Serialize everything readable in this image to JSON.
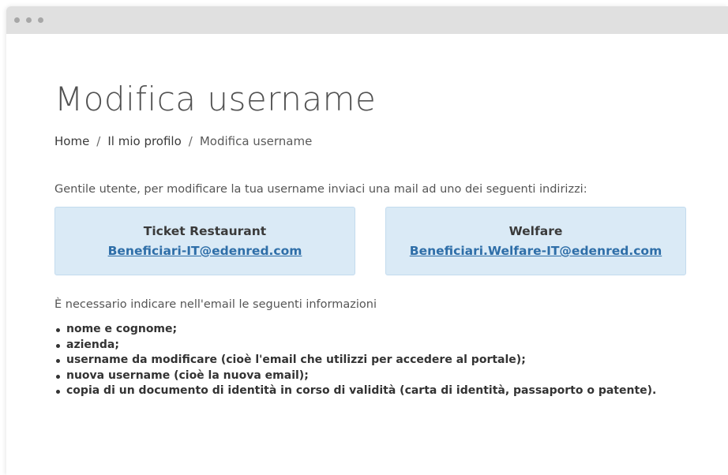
{
  "page": {
    "title": "Modifica username"
  },
  "breadcrumb": [
    "Home",
    "Il mio profilo",
    "Modifica username"
  ],
  "breadcrumb_separator": "/",
  "intro": "Gentile utente, per modificare la tua username inviaci una mail ad uno dei seguenti indirizzi:",
  "cards": [
    {
      "title": "Ticket Restaurant",
      "email": "Beneficiari-IT@edenred.com"
    },
    {
      "title": "Welfare",
      "email": "Beneficiari.Welfare-IT@edenred.com"
    }
  ],
  "info": "È necessario indicare nell'email le seguenti informazioni",
  "requirements": [
    "nome e cognome;",
    "azienda;",
    "username da modificare (cioè l'email che utilizzi per accedere al portale);",
    "nuova username (cioè la nuova email);",
    "copia di un documento di identità in corso di validità (carta di identità, passaporto o patente)."
  ],
  "colors": {
    "card_background": "#daeaf6",
    "link": "#2e6ea8",
    "titlebar": "#e0e0e0"
  }
}
